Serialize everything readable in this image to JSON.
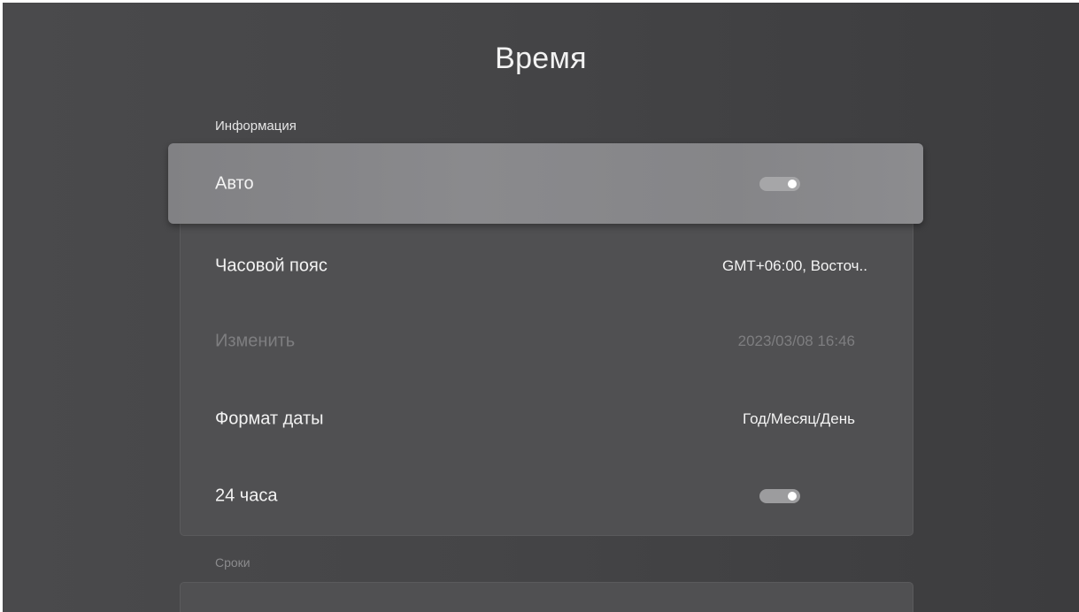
{
  "header": {
    "title": "Время"
  },
  "sections": {
    "info_label": "Информация",
    "terms_label": "Сроки"
  },
  "rows": {
    "auto": {
      "label": "Авто",
      "toggle_on": true
    },
    "timezone": {
      "label": "Часовой пояс",
      "value": "GMT+06:00, Восточ.."
    },
    "change": {
      "label": "Изменить",
      "value": "2023/03/08 16:46",
      "disabled": true
    },
    "date_format": {
      "label": "Формат даты",
      "value": "Год/Месяц/День"
    },
    "hour24": {
      "label": "24 часа",
      "toggle_on": true
    }
  },
  "colors": {
    "background": "#444446",
    "focus": "#88888b",
    "panel": "#505052",
    "text": "#f3f3f3",
    "disabled_text": "#7e7e80"
  }
}
